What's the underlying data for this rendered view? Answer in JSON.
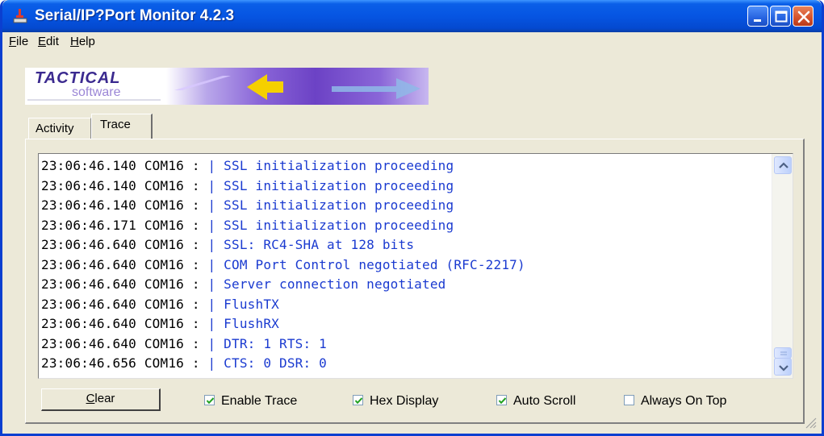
{
  "window": {
    "title": "Serial/IP?Port Monitor 4.2.3"
  },
  "menu": {
    "file": "File",
    "edit": "Edit",
    "help": "Help"
  },
  "banner": {
    "brand_top": "TACTICAL",
    "brand_bottom": "software"
  },
  "tabs": {
    "activity": "Activity",
    "trace": "Trace",
    "selected": "Trace"
  },
  "trace": {
    "lines": [
      {
        "time": "23:06:46.140",
        "port": "COM16",
        "message": "SSL initialization proceeding"
      },
      {
        "time": "23:06:46.140",
        "port": "COM16",
        "message": "SSL initialization proceeding"
      },
      {
        "time": "23:06:46.140",
        "port": "COM16",
        "message": "SSL initialization proceeding"
      },
      {
        "time": "23:06:46.171",
        "port": "COM16",
        "message": "SSL initialization proceeding"
      },
      {
        "time": "23:06:46.640",
        "port": "COM16",
        "message": "SSL: RC4-SHA at 128 bits"
      },
      {
        "time": "23:06:46.640",
        "port": "COM16",
        "message": "COM Port Control negotiated (RFC-2217)"
      },
      {
        "time": "23:06:46.640",
        "port": "COM16",
        "message": "Server connection negotiated"
      },
      {
        "time": "23:06:46.640",
        "port": "COM16",
        "message": "FlushTX"
      },
      {
        "time": "23:06:46.640",
        "port": "COM16",
        "message": "FlushRX"
      },
      {
        "time": "23:06:46.640",
        "port": "COM16",
        "message": "DTR: 1 RTS: 1"
      },
      {
        "time": "23:06:46.656",
        "port": "COM16",
        "message": "CTS: 0 DSR: 0"
      }
    ]
  },
  "controls": {
    "clear_label": "Clear",
    "enable_trace": {
      "label": "Enable Trace",
      "checked": true
    },
    "hex_display": {
      "label": "Hex Display",
      "checked": true
    },
    "auto_scroll": {
      "label": "Auto Scroll",
      "checked": true
    },
    "always_on_top": {
      "label": "Always On Top",
      "checked": false
    }
  },
  "colors": {
    "titlebar": "#0655e2",
    "trace_text": "#1a3ad0",
    "window_bg": "#ece9d8",
    "close_button": "#d5512b"
  }
}
